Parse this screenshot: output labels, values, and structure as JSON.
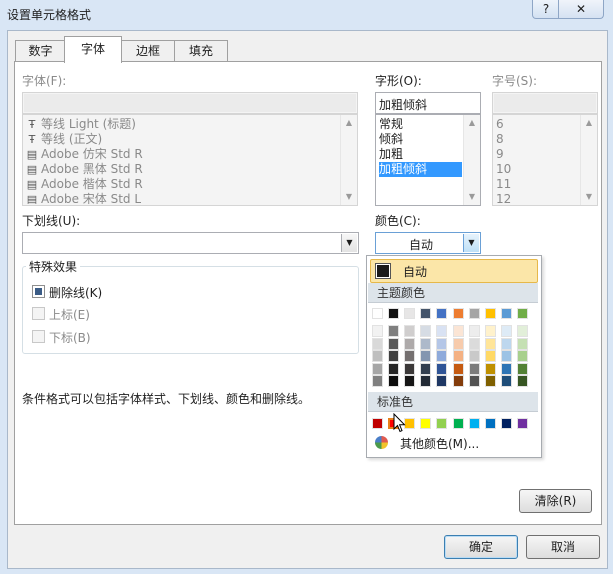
{
  "window": {
    "title": "设置单元格格式",
    "help": "?",
    "close": "✕"
  },
  "tabs": [
    {
      "label": "数字",
      "active": false
    },
    {
      "label": "字体",
      "active": true
    },
    {
      "label": "边框",
      "active": false
    },
    {
      "label": "填充",
      "active": false
    }
  ],
  "font": {
    "label": "字体(F):",
    "value": "",
    "items": [
      {
        "text": "等线 Light (标题)",
        "icon": "truetype-icon"
      },
      {
        "text": "等线 (正文)",
        "icon": "truetype-icon"
      },
      {
        "text": "Adobe 仿宋 Std R",
        "icon": "printer-font-icon"
      },
      {
        "text": "Adobe 黑体 Std R",
        "icon": "printer-font-icon"
      },
      {
        "text": "Adobe 楷体 Std R",
        "icon": "printer-font-icon"
      },
      {
        "text": "Adobe 宋体 Std L",
        "icon": "printer-font-icon"
      }
    ]
  },
  "style": {
    "label": "字形(O):",
    "value": "加粗倾斜",
    "items": [
      "常规",
      "倾斜",
      "加粗",
      "加粗倾斜"
    ],
    "selected": 3
  },
  "size": {
    "label": "字号(S):",
    "value": "",
    "items": [
      "6",
      "8",
      "9",
      "10",
      "11",
      "12"
    ]
  },
  "underline": {
    "label": "下划线(U):",
    "value": ""
  },
  "color": {
    "label": "颜色(C):",
    "value": "自动",
    "dropdown": {
      "auto_label": "自动",
      "theme_header": "主题颜色",
      "standard_header": "标准色",
      "more_label": "其他颜色(M)...",
      "theme_top": [
        "#ffffff",
        "#111111",
        "#e7e6e6",
        "#44546a",
        "#4472c4",
        "#ed7d31",
        "#a5a5a5",
        "#ffc000",
        "#5b9bd5",
        "#70ad47"
      ],
      "theme_shades": [
        [
          "#f2f2f2",
          "#d9d9d9",
          "#bfbfbf",
          "#a6a6a6",
          "#808080"
        ],
        [
          "#7f7f7f",
          "#595959",
          "#404040",
          "#262626",
          "#0d0d0d"
        ],
        [
          "#d0cece",
          "#aeaaaa",
          "#757070",
          "#3b3838",
          "#171616"
        ],
        [
          "#d6dce4",
          "#adb9ca",
          "#8496b0",
          "#333f4f",
          "#222a35"
        ],
        [
          "#d9e2f3",
          "#b4c6e7",
          "#8eaadb",
          "#2f5496",
          "#1f3864"
        ],
        [
          "#fbe5d5",
          "#f7cbac",
          "#f4b183",
          "#c55a11",
          "#833c0b"
        ],
        [
          "#ededed",
          "#dbdbdb",
          "#c9c9c9",
          "#7b7b7b",
          "#525252"
        ],
        [
          "#fff2cc",
          "#ffe599",
          "#ffd965",
          "#bf9000",
          "#7f6000"
        ],
        [
          "#deebf6",
          "#bdd7ee",
          "#9cc3e5",
          "#2e75b5",
          "#1f4e79"
        ],
        [
          "#e2efd9",
          "#c5e0b3",
          "#a8d08d",
          "#538135",
          "#375623"
        ]
      ],
      "standard": [
        "#c00000",
        "#ff0000",
        "#ffc000",
        "#ffff00",
        "#92d050",
        "#00b050",
        "#00b0f0",
        "#0070c0",
        "#002060",
        "#7030a0"
      ]
    }
  },
  "effects": {
    "title": "特殊效果",
    "strike": {
      "label": "删除线(K)",
      "checked": true
    },
    "super": {
      "label": "上标(E)",
      "checked": false
    },
    "sub": {
      "label": "下标(B)",
      "checked": false
    }
  },
  "note": "条件格式可以包括字体样式、下划线、颜色和删除线。",
  "buttons": {
    "clear": "清除(R)",
    "ok": "确定",
    "cancel": "取消"
  }
}
